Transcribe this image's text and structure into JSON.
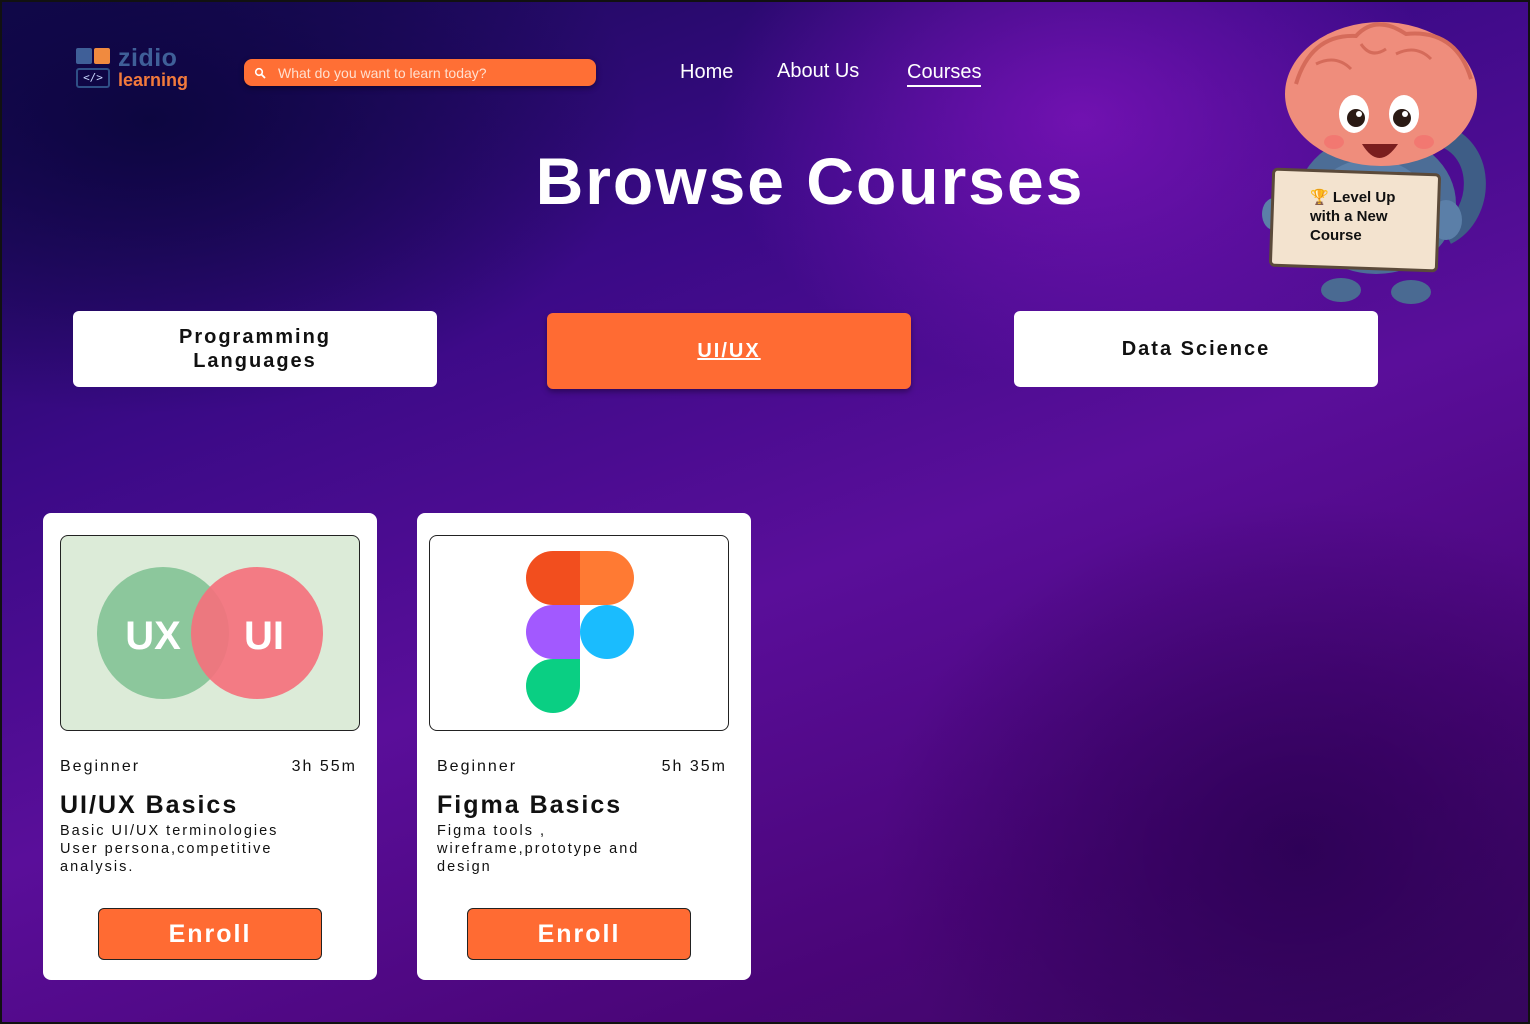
{
  "brand": {
    "name_line1": "zidio",
    "name_line2": "learning",
    "code_glyph": "</>"
  },
  "search": {
    "placeholder": "What do you want to learn today?"
  },
  "nav": {
    "items": [
      {
        "label": "Home",
        "active": false
      },
      {
        "label": "About Us",
        "active": false
      },
      {
        "label": "Courses",
        "active": true
      }
    ]
  },
  "page_title": "Browse Courses",
  "mascot": {
    "sign_line1": "🏆 Level Up",
    "sign_line2": "with a New",
    "sign_line3": "Course"
  },
  "categories": [
    {
      "label_line1": "Programming",
      "label_line2": "Languages",
      "active": false
    },
    {
      "label": "UI/UX",
      "active": true
    },
    {
      "label": "Data Science",
      "active": false
    }
  ],
  "courses": [
    {
      "thumb": {
        "left_text": "UX",
        "right_text": "UI"
      },
      "level": "Beginner",
      "duration": "3h 55m",
      "title": "UI/UX Basics",
      "desc_line1": "Basic UI/UX terminologies",
      "desc_line2": "User persona,competitive",
      "desc_line3": "analysis.",
      "button": "Enroll"
    },
    {
      "thumb": {
        "icon": "figma-logo-icon"
      },
      "level": "Beginner",
      "duration": "5h 35m",
      "title": "Figma Basics",
      "desc_line1": "Figma tools ,",
      "desc_line2": "wireframe,prototype and",
      "desc_line3": "design",
      "button": "Enroll"
    }
  ],
  "colors": {
    "accent": "#ff6b33",
    "brand_blue": "#3f5f98",
    "brand_orange": "#f27a3c",
    "ux_circle": "#8cc79c",
    "ui_circle": "#f4717d"
  }
}
